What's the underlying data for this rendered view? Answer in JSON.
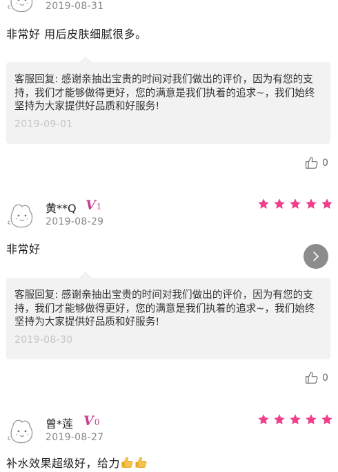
{
  "accent_color": "#ef3f8d",
  "vip_color": "#c2408f",
  "reviews": [
    {
      "username": "",
      "vip_level": "",
      "date": "2019-08-31",
      "rating": 5,
      "content": "非常好 用后皮肤细腻很多。",
      "reply": "客服回复: 感谢亲抽出宝贵的时间对我们做出的评价，因为有您的支持，我们才能够做得更好，您的满意是我们执着的追求~，我们始终坚持为大家提供好品质和好服务!",
      "reply_date": "2019-09-01",
      "likes": "0"
    },
    {
      "username": "黄**Q",
      "vip_level": "1",
      "date": "2019-08-29",
      "rating": 5,
      "content": "非常好",
      "reply": "客服回复: 感谢亲抽出宝贵的时间对我们做出的评价，因为有您的支持，我们才能够做得更好，您的满意是我们执着的追求~，我们始终坚持为大家提供好品质和好服务!",
      "reply_date": "2019-08-30",
      "likes": "0"
    },
    {
      "username": "曾*莲",
      "vip_level": "0",
      "date": "2019-08-27",
      "rating": 5,
      "content": "补水效果超级好，给力",
      "content_icons": [
        "thumbs-up-emoji",
        "thumbs-up-emoji"
      ]
    }
  ]
}
